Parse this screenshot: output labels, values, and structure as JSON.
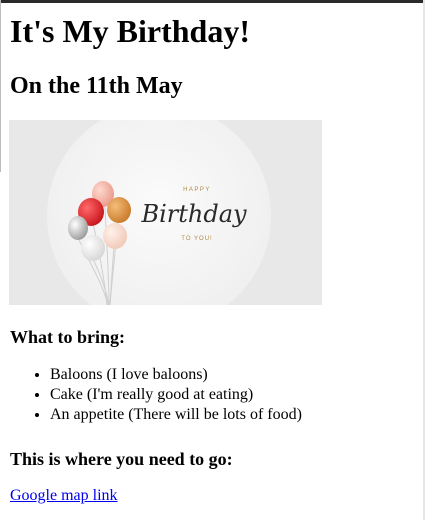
{
  "page": {
    "title": "It's My Birthday!",
    "date_heading": "On the 11th May"
  },
  "image": {
    "happy_text": "HAPPY",
    "script_text": "Birthday",
    "to_you_text": "TO YOU!"
  },
  "bring": {
    "heading": "What to bring:",
    "items": [
      "Baloons (I love baloons)",
      "Cake (I'm really good at eating)",
      "An appetite (There will be lots of food)"
    ]
  },
  "directions": {
    "heading": "This is where you need to go:",
    "link_text": "Google map link"
  }
}
